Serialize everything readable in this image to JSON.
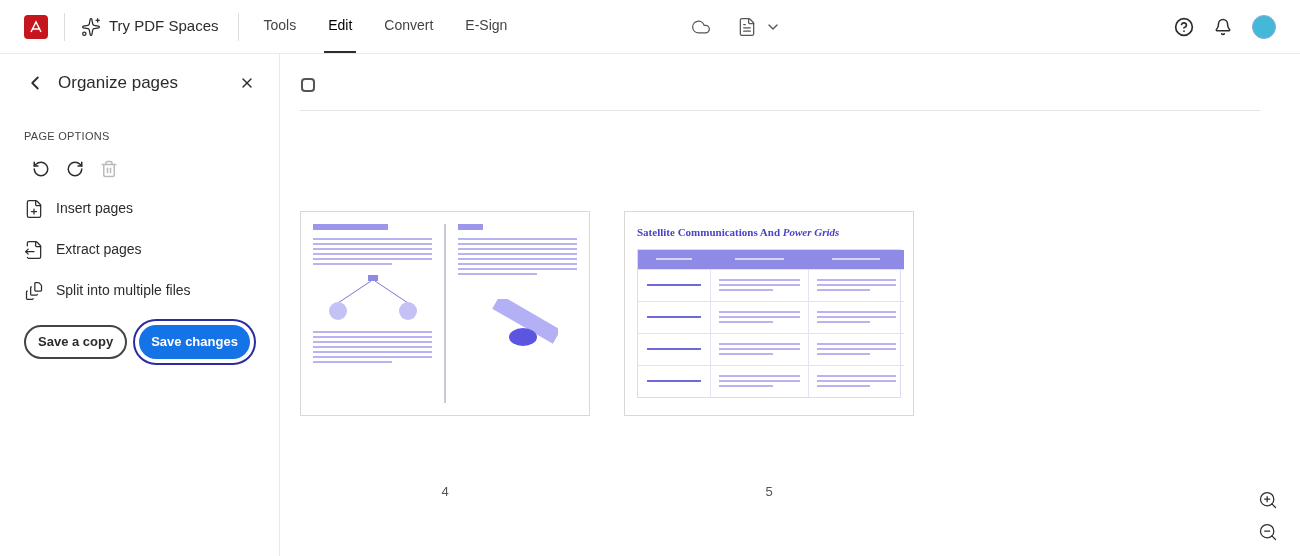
{
  "header": {
    "app_link": "Try PDF Spaces",
    "nav": [
      {
        "label": "Tools",
        "selected": false
      },
      {
        "label": "Edit",
        "selected": true
      },
      {
        "label": "Convert",
        "selected": false
      },
      {
        "label": "E-Sign",
        "selected": false
      }
    ]
  },
  "panel": {
    "title": "Organize pages",
    "section": "PAGE OPTIONS",
    "actions": [
      {
        "kind": "insert",
        "label": "Insert pages"
      },
      {
        "kind": "extract",
        "label": "Extract pages"
      },
      {
        "kind": "split",
        "label": "Split into multiple files"
      }
    ],
    "buttons": [
      {
        "label": "Save a copy",
        "primary": false
      },
      {
        "label": "Save changes",
        "primary": true
      }
    ]
  },
  "select_all": {
    "checked": false
  },
  "pages": [
    {
      "kind": "text",
      "number": "4"
    },
    {
      "kind": "table",
      "number": "5",
      "title": "Satellite Communications And *Power Grids*"
    }
  ]
}
